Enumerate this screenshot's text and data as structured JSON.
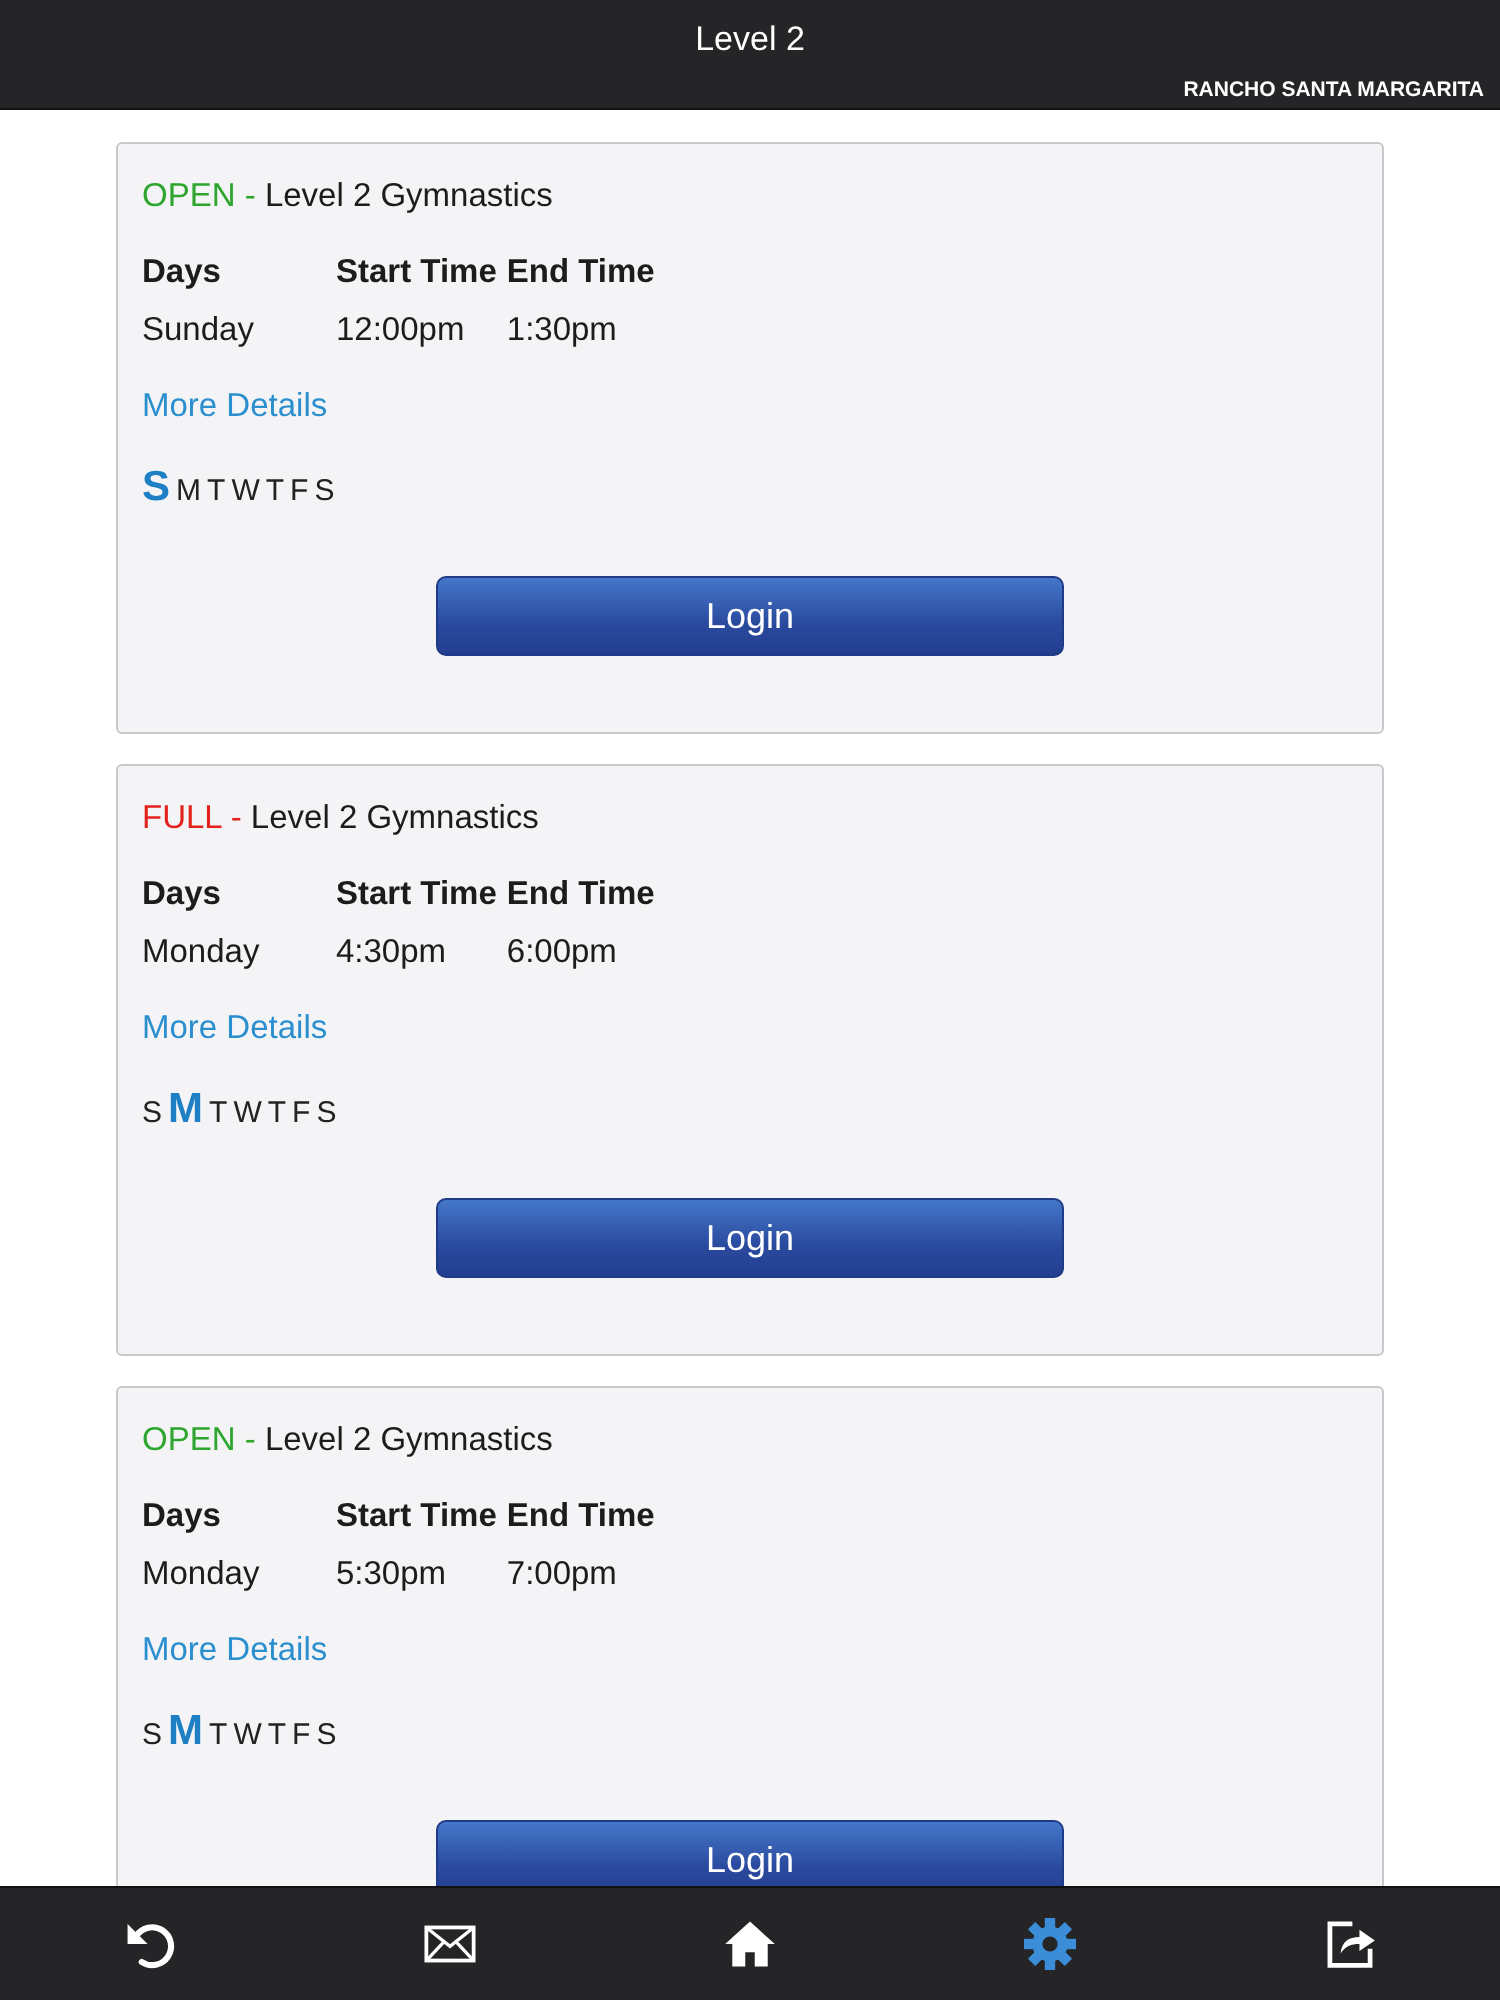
{
  "header": {
    "title": "Level 2",
    "location": "RANCHO SANTA MARGARITA"
  },
  "sessions": [
    {
      "status": "OPEN -",
      "color": "#2ea52e",
      "title": "Level 2 Gymnastics",
      "columns": [
        "Days",
        "Start Time",
        "End Time"
      ],
      "values": [
        "Sunday",
        "12:00pm",
        "1:30pm"
      ],
      "link": "More Details",
      "days": [
        {
          "letter": "S",
          "selected": true
        },
        {
          "letter": "M",
          "selected": false
        },
        {
          "letter": "T",
          "selected": false
        },
        {
          "letter": "W",
          "selected": false
        },
        {
          "letter": "T",
          "selected": false
        },
        {
          "letter": "F",
          "selected": false
        },
        {
          "letter": "S",
          "selected": false
        }
      ],
      "button": "Login"
    },
    {
      "status": "FULL -",
      "color": "#e3211d",
      "title": "Level 2 Gymnastics",
      "columns": [
        "Days",
        "Start Time",
        "End Time"
      ],
      "values": [
        "Monday",
        "4:30pm",
        "6:00pm"
      ],
      "link": "More Details",
      "days": [
        {
          "letter": "S",
          "selected": false
        },
        {
          "letter": "M",
          "selected": true
        },
        {
          "letter": "T",
          "selected": false
        },
        {
          "letter": "W",
          "selected": false
        },
        {
          "letter": "T",
          "selected": false
        },
        {
          "letter": "F",
          "selected": false
        },
        {
          "letter": "S",
          "selected": false
        }
      ],
      "button": "Login"
    },
    {
      "status": "OPEN -",
      "color": "#2ea52e",
      "title": "Level 2 Gymnastics",
      "columns": [
        "Days",
        "Start Time",
        "End Time"
      ],
      "values": [
        "Monday",
        "5:30pm",
        "7:00pm"
      ],
      "link": "More Details",
      "days": [
        {
          "letter": "S",
          "selected": false
        },
        {
          "letter": "M",
          "selected": true
        },
        {
          "letter": "T",
          "selected": false
        },
        {
          "letter": "W",
          "selected": false
        },
        {
          "letter": "T",
          "selected": false
        },
        {
          "letter": "F",
          "selected": false
        },
        {
          "letter": "S",
          "selected": false
        }
      ],
      "button": "Login"
    }
  ],
  "tab_bar": [
    {
      "kind": "undo",
      "selected": false
    },
    {
      "kind": "mail",
      "selected": false
    },
    {
      "kind": "home",
      "selected": false
    },
    {
      "kind": "settings",
      "selected": true
    },
    {
      "kind": "share",
      "selected": false
    }
  ]
}
